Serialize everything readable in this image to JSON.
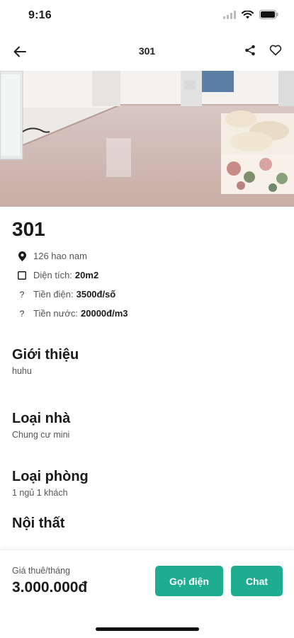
{
  "status_bar": {
    "time": "9:16"
  },
  "nav": {
    "title": "301"
  },
  "room": {
    "title": "301",
    "address": "126 hao nam",
    "area_label": "Diện tích:",
    "area_value": "20m2",
    "electric_label": "Tiền điện:",
    "electric_value": "3500đ/số",
    "water_label": "Tiền nước:",
    "water_value": "20000đ/m3"
  },
  "sections": {
    "intro": {
      "title": "Giới thiệu",
      "value": "huhu"
    },
    "house_type": {
      "title": "Loại nhà",
      "value": "Chung cư mini"
    },
    "room_type": {
      "title": "Loại phòng",
      "value": "1 ngủ 1 khách"
    },
    "furniture": {
      "title": "Nội thất"
    }
  },
  "bottom": {
    "price_label": "Giá thuê/tháng",
    "price_value": "3.000.000đ",
    "call_label": "Gọi điện",
    "chat_label": "Chat"
  },
  "colors": {
    "accent": "#1fad91"
  },
  "icons": [
    "back-arrow-icon",
    "share-icon",
    "heart-icon",
    "location-pin-icon",
    "area-icon",
    "question-icon"
  ]
}
